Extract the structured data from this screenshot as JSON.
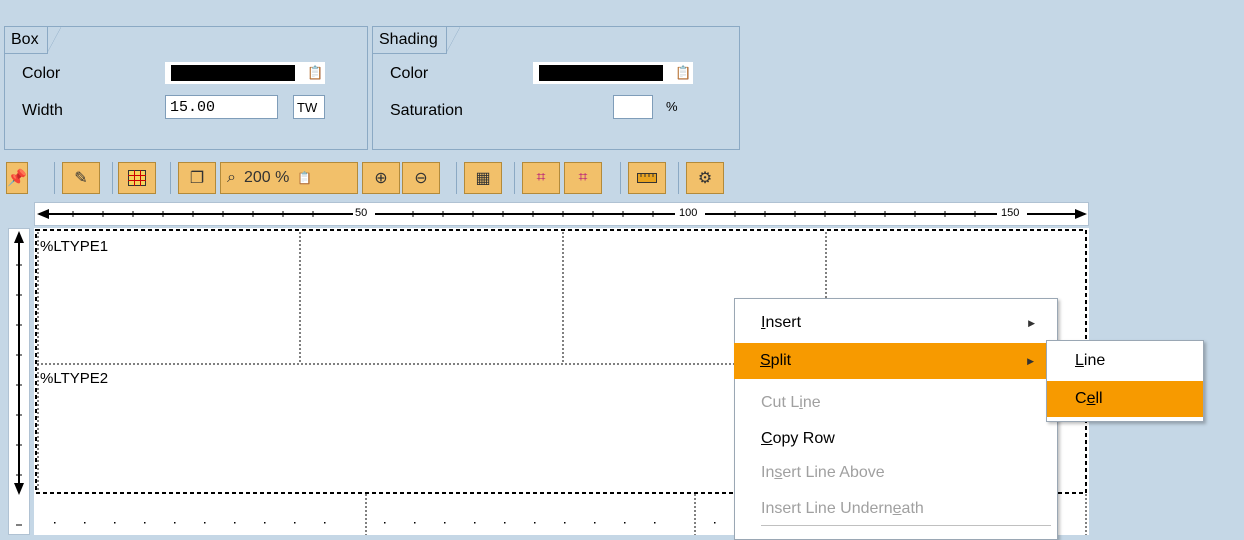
{
  "box": {
    "tab": "Box",
    "color_label": "Color",
    "width_label": "Width",
    "width_value": "15.00",
    "width_unit": "TW",
    "dropdown_icon": "f4-help-icon"
  },
  "shading": {
    "tab": "Shading",
    "color_label": "Color",
    "saturation_label": "Saturation",
    "saturation_value": "",
    "saturation_unit": "%"
  },
  "toolbar": {
    "zoom": "200 %",
    "icons": [
      "pin-icon",
      "pencil-icon",
      "table-icon",
      "copy-icon",
      "zoom-select-icon",
      "zoom-in-icon",
      "zoom-out-icon",
      "layout-icon",
      "grid-icon",
      "grid2-icon",
      "ruler-icon",
      "settings-icon"
    ]
  },
  "ruler": {
    "marks": [
      "50",
      "100",
      "150"
    ]
  },
  "canvas": {
    "line_type_1": "%LTYPE1",
    "line_type_2": "%LTYPE2"
  },
  "context_menu": {
    "items": [
      {
        "label_pre": "",
        "label_u": "I",
        "label_post": "nsert",
        "enabled": true,
        "submenu": true
      },
      {
        "label_pre": "",
        "label_u": "S",
        "label_post": "plit",
        "enabled": true,
        "submenu": true,
        "highlighted": true
      },
      {
        "label_pre": "Cut L",
        "label_u": "i",
        "label_post": "ne",
        "enabled": false
      },
      {
        "label_pre": "",
        "label_u": "C",
        "label_post": "opy Row",
        "enabled": true
      },
      {
        "label_pre": "In",
        "label_u": "s",
        "label_post": "ert Line Above",
        "enabled": false
      },
      {
        "label_pre": "Insert Line Undern",
        "label_u": "e",
        "label_post": "ath",
        "enabled": false
      }
    ],
    "split_submenu": [
      {
        "label_pre": "",
        "label_u": "L",
        "label_post": "ine"
      },
      {
        "label_pre": "C",
        "label_u": "e",
        "label_post": "ll",
        "highlighted": true
      }
    ]
  },
  "colors": {
    "background": "#c5d7e6",
    "highlight": "#f79a00",
    "toolbar_button": "#f2c06a"
  }
}
